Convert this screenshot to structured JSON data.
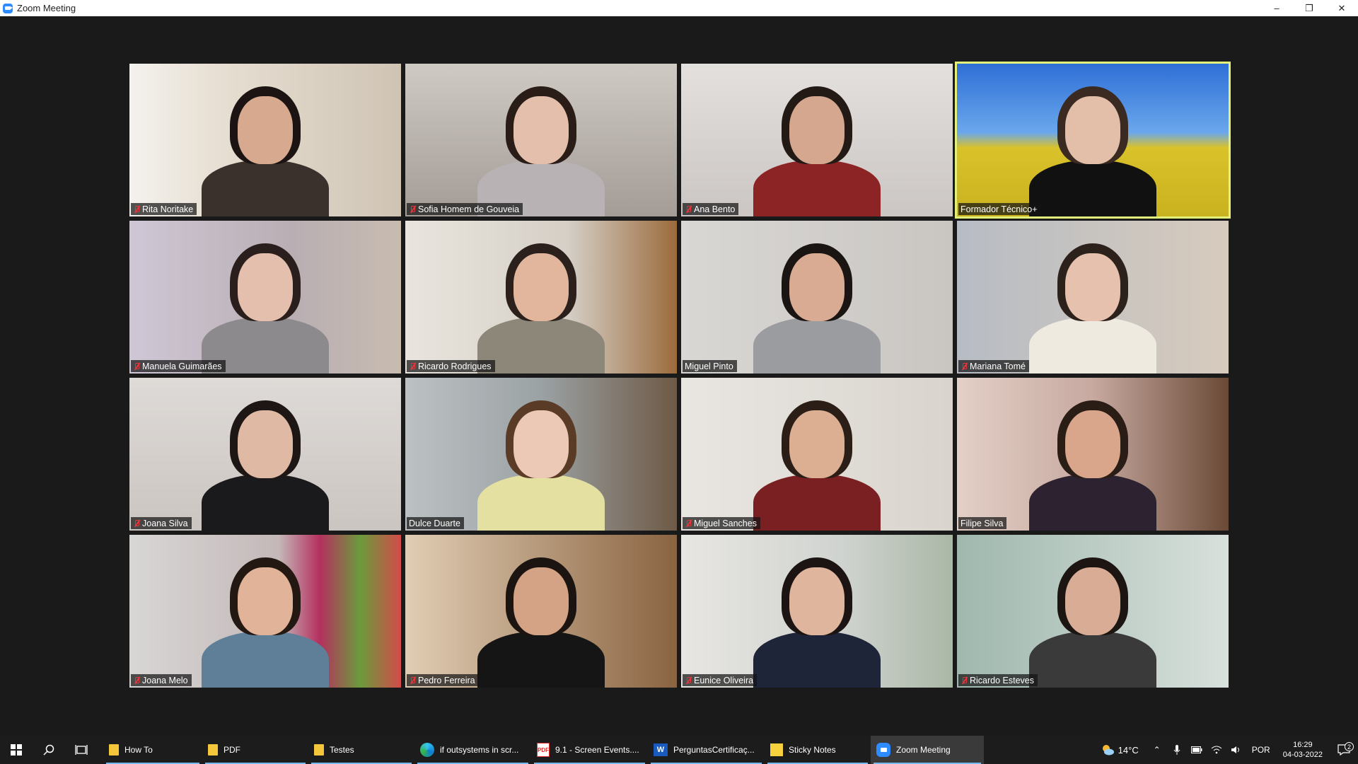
{
  "window": {
    "title": "Zoom Meeting",
    "minimize": "–",
    "restore": "❐",
    "close": "✕"
  },
  "participants": [
    {
      "name": "Rita Noritake",
      "muted": true,
      "active": false
    },
    {
      "name": "Sofia Homem de Gouveia",
      "muted": true,
      "active": false
    },
    {
      "name": "Ana Bento",
      "muted": true,
      "active": false
    },
    {
      "name": "Formador Técnico+",
      "muted": false,
      "active": true
    },
    {
      "name": "Manuela Guimarães",
      "muted": true,
      "active": false
    },
    {
      "name": "Ricardo Rodrigues",
      "muted": true,
      "active": false
    },
    {
      "name": "Miguel Pinto",
      "muted": false,
      "active": false
    },
    {
      "name": "Mariana Tomé",
      "muted": true,
      "active": false
    },
    {
      "name": "Joana Silva",
      "muted": true,
      "active": false
    },
    {
      "name": "Dulce Duarte",
      "muted": false,
      "active": false
    },
    {
      "name": "Miguel Sanches",
      "muted": true,
      "active": false
    },
    {
      "name": "Filipe Silva",
      "muted": false,
      "active": false
    },
    {
      "name": "Joana Melo",
      "muted": true,
      "active": false
    },
    {
      "name": "Pedro Ferreira",
      "muted": true,
      "active": false
    },
    {
      "name": "Eunice Oliveira",
      "muted": true,
      "active": false
    },
    {
      "name": "Ricardo Esteves",
      "muted": true,
      "active": false
    }
  ],
  "taskbar": {
    "items": [
      {
        "label": "How To",
        "icon": "folder-icon"
      },
      {
        "label": "PDF",
        "icon": "folder-icon"
      },
      {
        "label": "Testes",
        "icon": "folder-icon"
      },
      {
        "label": "if outsystems in scr...",
        "icon": "edge-icon"
      },
      {
        "label": "9.1 - Screen Events....",
        "icon": "pdf-icon"
      },
      {
        "label": "PerguntasCertificaç...",
        "icon": "word-icon"
      },
      {
        "label": "Sticky Notes",
        "icon": "sticky-notes-icon"
      },
      {
        "label": "Zoom Meeting",
        "icon": "zoom-icon"
      }
    ],
    "tray": {
      "temperature": "14°C",
      "language": "POR",
      "time": "16:29",
      "date": "04-03-2022",
      "notifications": "2"
    }
  },
  "colors": {
    "active_speaker": "#e3f07a",
    "muted_icon": "#e6343a",
    "zoom_blue": "#2d8cff"
  }
}
